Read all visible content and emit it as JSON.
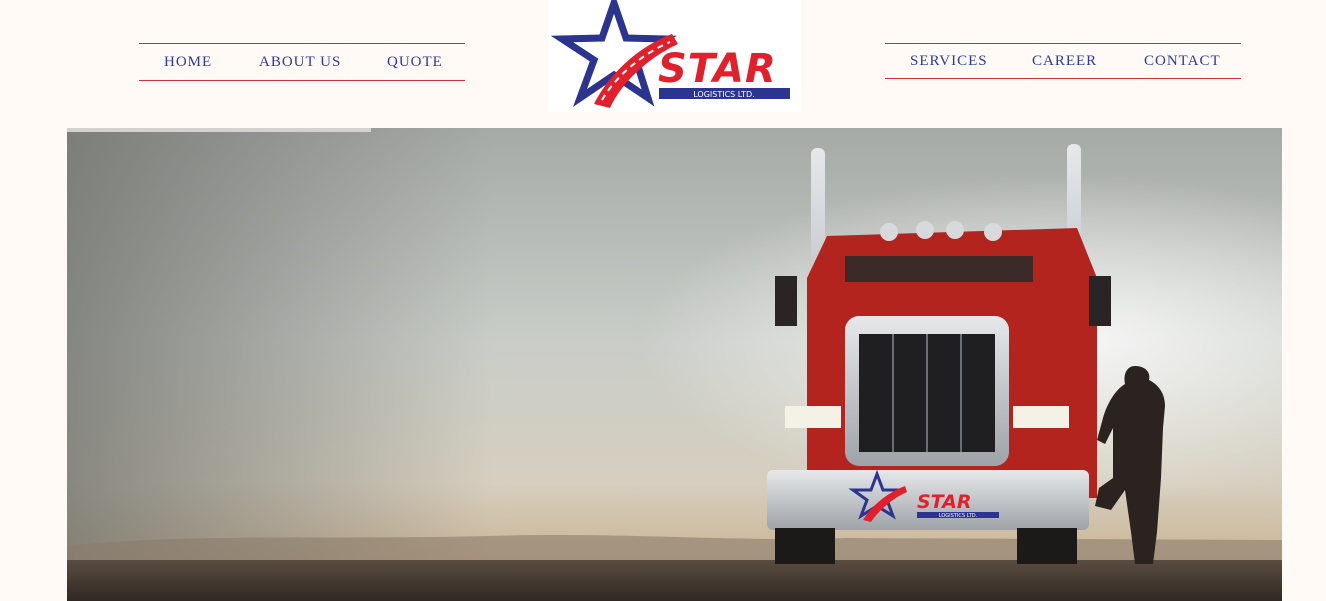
{
  "nav": {
    "left": [
      {
        "label": "HOME"
      },
      {
        "label": "ABOUT US"
      },
      {
        "label": "QUOTE"
      }
    ],
    "right": [
      {
        "label": "SERVICES"
      },
      {
        "label": "CAREER"
      },
      {
        "label": "CONTACT"
      }
    ]
  },
  "logo": {
    "word": "STAR",
    "subtitle": "LOGISTICS LTD."
  },
  "hero": {
    "truck_badge_word": "STAR",
    "truck_badge_subtitle": "LOGISTICS LTD."
  },
  "colors": {
    "nav_text": "#2b3a9c",
    "nav_rule": "#c8323a",
    "brand_red": "#e2202c",
    "brand_blue": "#2b3590"
  }
}
